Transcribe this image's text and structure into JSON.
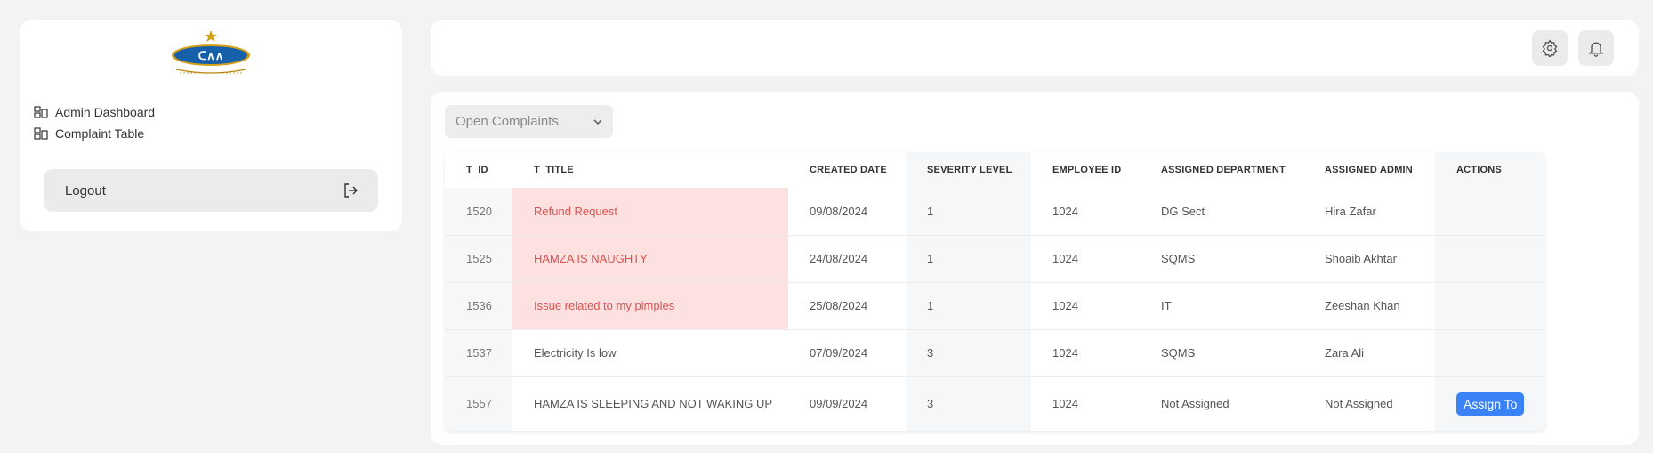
{
  "sidebar": {
    "nav": [
      {
        "label": "Admin Dashboard",
        "icon": "dashboard-icon"
      },
      {
        "label": "Complaint Table",
        "icon": "table-icon"
      }
    ],
    "logout_label": "Logout",
    "logo_text": "CAA"
  },
  "topbar": {
    "settings_icon": "gear-icon",
    "notification_icon": "bell-icon"
  },
  "main": {
    "filter": {
      "selected": "Open Complaints"
    },
    "table": {
      "headers": [
        "T_ID",
        "T_TITLE",
        "CREATED DATE",
        "SEVERITY LEVEL",
        "EMPLOYEE ID",
        "ASSIGNED DEPARTMENT",
        "ASSIGNED ADMIN",
        "ACTIONS"
      ],
      "rows": [
        {
          "id": "1520",
          "title": "Refund Request",
          "date": "09/08/2024",
          "severity": "1",
          "employee": "1024",
          "department": "DG Sect",
          "admin": "Hira Zafar",
          "highlight": true
        },
        {
          "id": "1525",
          "title": "HAMZA IS NAUGHTY",
          "date": "24/08/2024",
          "severity": "1",
          "employee": "1024",
          "department": "SQMS",
          "admin": "Shoaib Akhtar",
          "highlight": true
        },
        {
          "id": "1536",
          "title": "Issue related to my pimples",
          "date": "25/08/2024",
          "severity": "1",
          "employee": "1024",
          "department": "IT",
          "admin": "Zeeshan Khan",
          "highlight": true
        },
        {
          "id": "1537",
          "title": "Electricity Is low",
          "date": "07/09/2024",
          "severity": "3",
          "employee": "1024",
          "department": "SQMS",
          "admin": "Zara Ali",
          "highlight": false
        },
        {
          "id": "1557",
          "title": "HAMZA IS SLEEPING AND NOT WAKING UP",
          "date": "09/09/2024",
          "severity": "3",
          "employee": "1024",
          "department": "Not Assigned",
          "admin": "Not Assigned",
          "highlight": false,
          "action": "Assign To"
        }
      ]
    }
  },
  "colors": {
    "accent": "#3b82f6",
    "highlight_bg": "#fde0e0",
    "highlight_text": "#d9534f",
    "logo_blue": "#1560a8",
    "logo_gold": "#d4a017"
  }
}
